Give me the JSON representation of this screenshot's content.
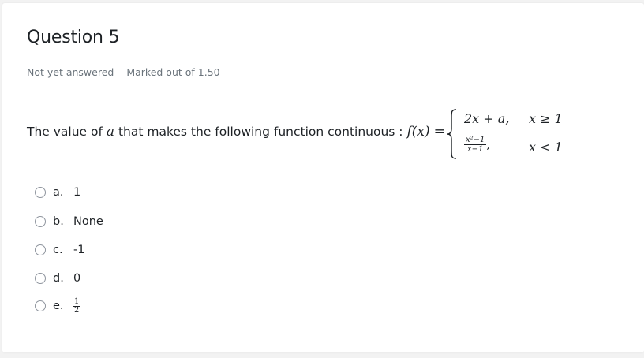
{
  "question": {
    "title": "Question 5",
    "state": "Not yet answered",
    "marks": "Marked out of 1.50",
    "stem_text": "The value of ",
    "stem_var": "a",
    "stem_text2": " that makes the following function continuous : ",
    "function_lhs": "f(x)",
    "equals": "=",
    "cases": [
      {
        "expr": "2x + a,",
        "condition": "x ≥ 1"
      },
      {
        "expr_num": "x²−1",
        "expr_den": "x−1",
        "expr_suffix": ",",
        "condition": "x < 1"
      }
    ]
  },
  "options": [
    {
      "letter": "a.",
      "text": "1"
    },
    {
      "letter": "b.",
      "text": "None"
    },
    {
      "letter": "c.",
      "text": "-1"
    },
    {
      "letter": "d.",
      "text": "0"
    },
    {
      "letter": "e.",
      "frac_num": "1",
      "frac_den": "2"
    }
  ]
}
